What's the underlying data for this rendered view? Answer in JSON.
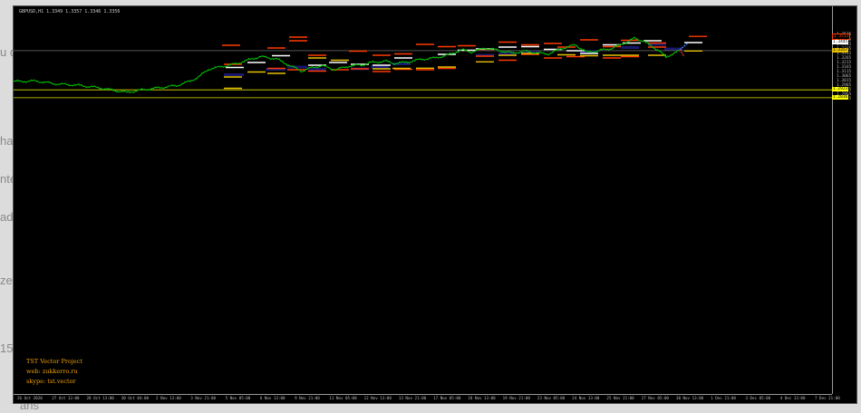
{
  "background_fragments": [
    "u d",
    "ha",
    "nte",
    "ad",
    "ze",
    "15",
    "ans"
  ],
  "chart": {
    "symbol_header": "GBPUSD,H1  1.3349 1.3357 1.3346 1.3356",
    "price_ticks": [
      "1.3525",
      "1.3465",
      "1.3415",
      "1.3365",
      "1.3315",
      "1.3265",
      "1.3215",
      "1.3165",
      "1.3115",
      "1.3065",
      "1.3015",
      "1.2965",
      "1.2915",
      "1.2865",
      "1.2815"
    ],
    "price_labels": [
      {
        "text": "1.3513",
        "color": "#ff3a00",
        "price": 1.3513
      },
      {
        "text": "1.3445",
        "color": "#ffffff",
        "price": 1.3445
      },
      {
        "text": "1.3356",
        "color": "#c0c0c0",
        "price": 1.3356
      },
      {
        "text": "1.3357",
        "color": "#e8c000",
        "price": 1.3352
      },
      {
        "text": "1.2923",
        "color": "#ffff00",
        "price": 1.2923
      },
      {
        "text": "1.2836",
        "color": "#ffff00",
        "price": 1.2836
      }
    ],
    "time_ticks": [
      "26 Oct 2020",
      "27 Oct 13:00",
      "28 Oct 13:00",
      "30 Oct 04:00",
      "2 Nov 13:00",
      "3 Nov 21:00",
      "5 Nov 05:00",
      "6 Nov 13:00",
      "9 Nov 21:00",
      "11 Nov 05:00",
      "12 Nov 13:00",
      "13 Nov 21:00",
      "17 Nov 05:00",
      "18 Nov 13:00",
      "19 Nov 21:00",
      "23 Nov 05:00",
      "24 Nov 13:00",
      "25 Nov 21:00",
      "27 Nov 05:00",
      "30 Nov 13:00",
      "1 Dec 21:00",
      "3 Dec 05:00",
      "4 Dec 13:00",
      "7 Dec 21:00"
    ],
    "watermark": [
      "TST Vector Project",
      "web: zukkerro.ru",
      "skype: tst.vector"
    ],
    "colors": {
      "candles": "#00c000",
      "box": "#1c1c80",
      "red_level": "#ff3a00",
      "white_level": "#ffffff",
      "yellow_level": "#e8c000",
      "orange_level": "#ff8000"
    }
  }
}
